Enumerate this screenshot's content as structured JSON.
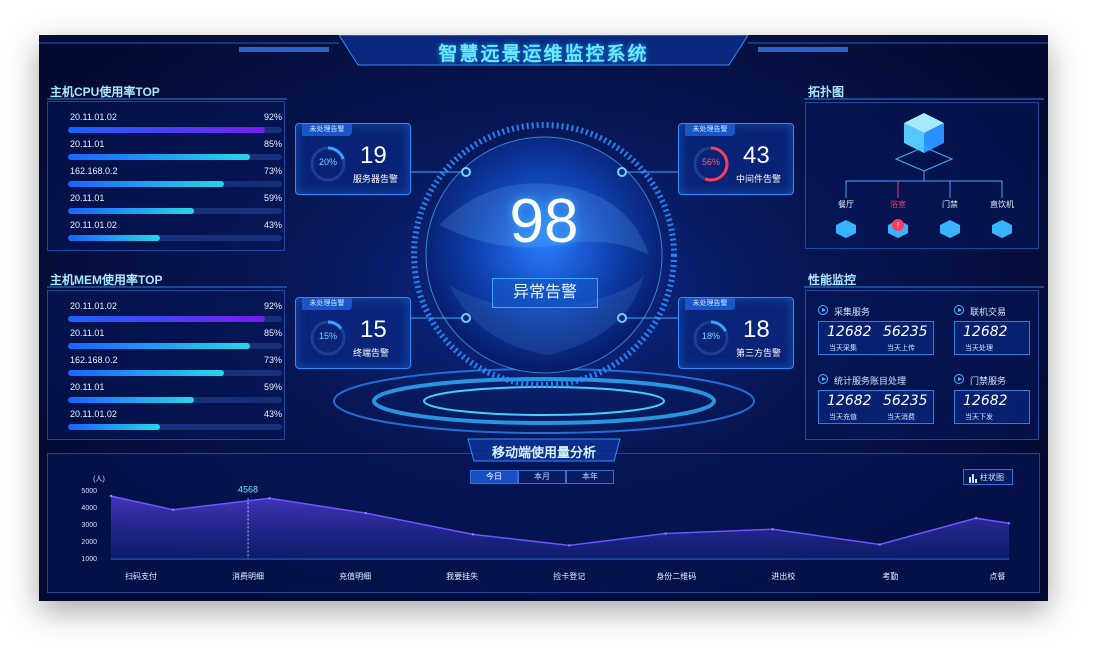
{
  "header": {
    "title": "智慧远景运维监控系统"
  },
  "cpu_panel": {
    "title": "主机CPU使用率TOP",
    "rows": [
      {
        "host": "20.11.01.02",
        "value": "92%",
        "pct": 92
      },
      {
        "host": "20.11.01",
        "value": "85%",
        "pct": 85
      },
      {
        "host": "162.168.0.2",
        "value": "73%",
        "pct": 73
      },
      {
        "host": "20.11.01",
        "value": "59%",
        "pct": 59
      },
      {
        "host": "20.11.01.02",
        "value": "43%",
        "pct": 43
      }
    ]
  },
  "mem_panel": {
    "title": "主机MEM使用率TOP",
    "rows": [
      {
        "host": "20.11.01.02",
        "value": "92%",
        "pct": 92
      },
      {
        "host": "20.11.01",
        "value": "85%",
        "pct": 85
      },
      {
        "host": "162.168.0.2",
        "value": "73%",
        "pct": 73
      },
      {
        "host": "20.11.01",
        "value": "59%",
        "pct": 59
      },
      {
        "host": "20.11.01.02",
        "value": "43%",
        "pct": 43
      }
    ]
  },
  "center": {
    "total": "98",
    "label": "异常告警"
  },
  "alarms": [
    {
      "tag": "未处理告警",
      "percent": "20%",
      "pct": 20,
      "count": "19",
      "label": "服务器告警",
      "ring_color": "#3aa0ff",
      "warn": false
    },
    {
      "tag": "未处理告警",
      "percent": "56%",
      "pct": 56,
      "count": "43",
      "label": "中间件告警",
      "ring_color": "#ff3b5c",
      "warn": true
    },
    {
      "tag": "未处理告警",
      "percent": "15%",
      "pct": 15,
      "count": "15",
      "label": "终端告警",
      "ring_color": "#3aa0ff",
      "warn": false
    },
    {
      "tag": "未处理告警",
      "percent": "18%",
      "pct": 18,
      "count": "18",
      "label": "第三方告警",
      "ring_color": "#3aa0ff",
      "warn": false
    }
  ],
  "topology": {
    "title": "拓扑图",
    "nodes": [
      "餐厅",
      "浴室",
      "门禁",
      "直饮机"
    ],
    "alert_node": "浴室",
    "alert_color": "#ff3b5c"
  },
  "performance": {
    "title": "性能监控",
    "cards": [
      {
        "name": "采集服务",
        "metrics": [
          {
            "value": "12682",
            "label": "当天采集"
          },
          {
            "value": "56235",
            "label": "当天上传"
          }
        ]
      },
      {
        "name": "联机交易",
        "metrics": [
          {
            "value": "12682",
            "label": "当天处理"
          }
        ]
      },
      {
        "name": "统计服务账目处理",
        "metrics": [
          {
            "value": "12682",
            "label": "当天充值"
          },
          {
            "value": "56235",
            "label": "当天消费"
          }
        ]
      },
      {
        "name": "门禁服务",
        "metrics": [
          {
            "value": "12682",
            "label": "当天下发"
          }
        ]
      }
    ]
  },
  "usage": {
    "title": "移动端使用量分析",
    "tabs": [
      "今日",
      "本月",
      "本年"
    ],
    "active_tab": 0,
    "chart_toggle": "柱状图"
  },
  "chart_data": {
    "type": "area",
    "title": "",
    "xlabel": "",
    "ylabel": "(人)",
    "categories": [
      "扫码支付",
      "消费明细",
      "充值明细",
      "我要挂失",
      "捡卡登记",
      "身份二维码",
      "进出校",
      "考勤",
      "点餐"
    ],
    "x_points": [
      -0.5,
      0.3,
      1.2,
      2.1,
      3.1,
      4.0,
      4.9,
      5.9,
      6.9,
      7.8,
      8.7
    ],
    "values": [
      4700,
      3900,
      4568,
      3700,
      2450,
      1800,
      2500,
      2750,
      1850,
      3400,
      3100
    ],
    "ylim": [
      1000,
      5000
    ],
    "yticks": [
      1000,
      2000,
      3000,
      4000,
      5000
    ],
    "highlight": {
      "category": "消费明细",
      "value": "4568"
    },
    "series_color": "#5a3fe0",
    "grid": false
  }
}
